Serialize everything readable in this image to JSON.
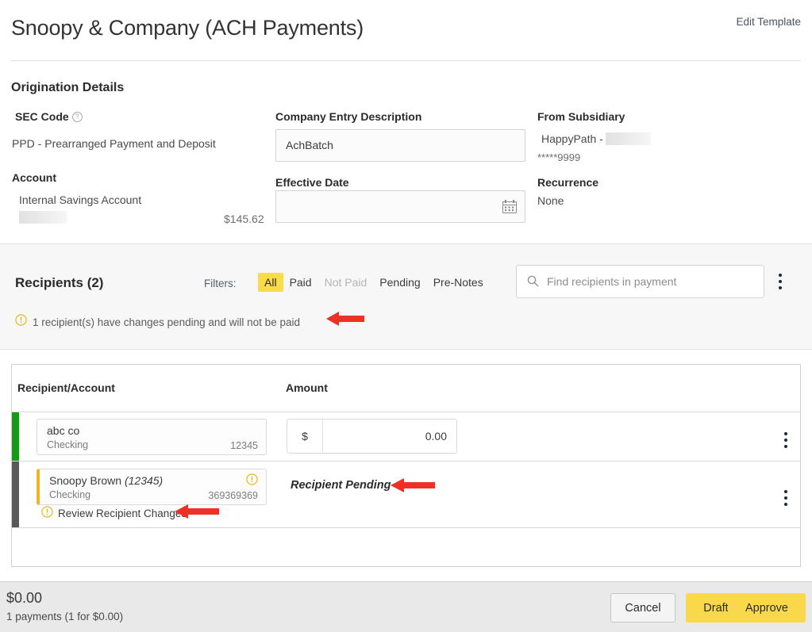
{
  "header": {
    "title": "Snoopy & Company (ACH Payments)",
    "edit_template": "Edit Template"
  },
  "origination": {
    "section_title": "Origination Details",
    "sec_code_label": "SEC Code",
    "sec_code_value": "PPD - Prearranged Payment and Deposit",
    "account_label": "Account",
    "account_value": "Internal Savings Account",
    "account_balance": "$145.62",
    "company_entry_label": "Company Entry Description",
    "company_entry_value": "AchBatch",
    "effective_date_label": "Effective Date",
    "effective_date_value": "",
    "from_subsidiary_label": "From Subsidiary",
    "from_subsidiary_value": "HappyPath -",
    "from_subsidiary_account": "*****9999",
    "recurrence_label": "Recurrence",
    "recurrence_value": "None"
  },
  "recipients": {
    "title": "Recipients (2)",
    "filters_label": "Filters:",
    "filters": [
      {
        "label": "All",
        "state": "active"
      },
      {
        "label": "Paid",
        "state": "normal"
      },
      {
        "label": "Not Paid",
        "state": "disabled"
      },
      {
        "label": "Pending",
        "state": "normal"
      },
      {
        "label": "Pre-Notes",
        "state": "normal"
      }
    ],
    "search_placeholder": "Find recipients in payment",
    "warning": "1 recipient(s) have changes pending and will not be paid"
  },
  "table": {
    "columns": [
      "Recipient/Account",
      "Amount"
    ],
    "rows": [
      {
        "status_color": "#139b13",
        "name": "abc co",
        "name_suffix": "",
        "account_type": "Checking",
        "account_number": "12345",
        "pending": false,
        "currency": "$",
        "amount": "0.00"
      },
      {
        "status_color": "#595959",
        "name": "Snoopy Brown",
        "name_suffix": "(12345)",
        "account_type": "Checking",
        "account_number": "369369369",
        "pending": true,
        "pending_text": "Recipient Pending",
        "review_link": "Review Recipient Changes"
      }
    ]
  },
  "footer": {
    "total": "$0.00",
    "summary": "1 payments (1 for $0.00)",
    "cancel": "Cancel",
    "draft": "Draft",
    "approve": "Approve"
  },
  "colors": {
    "accent_yellow": "#f9d84b",
    "warning_amber": "#e8b100",
    "status_green": "#139b13",
    "status_gray": "#595959",
    "annotation_red": "#ee3124"
  }
}
